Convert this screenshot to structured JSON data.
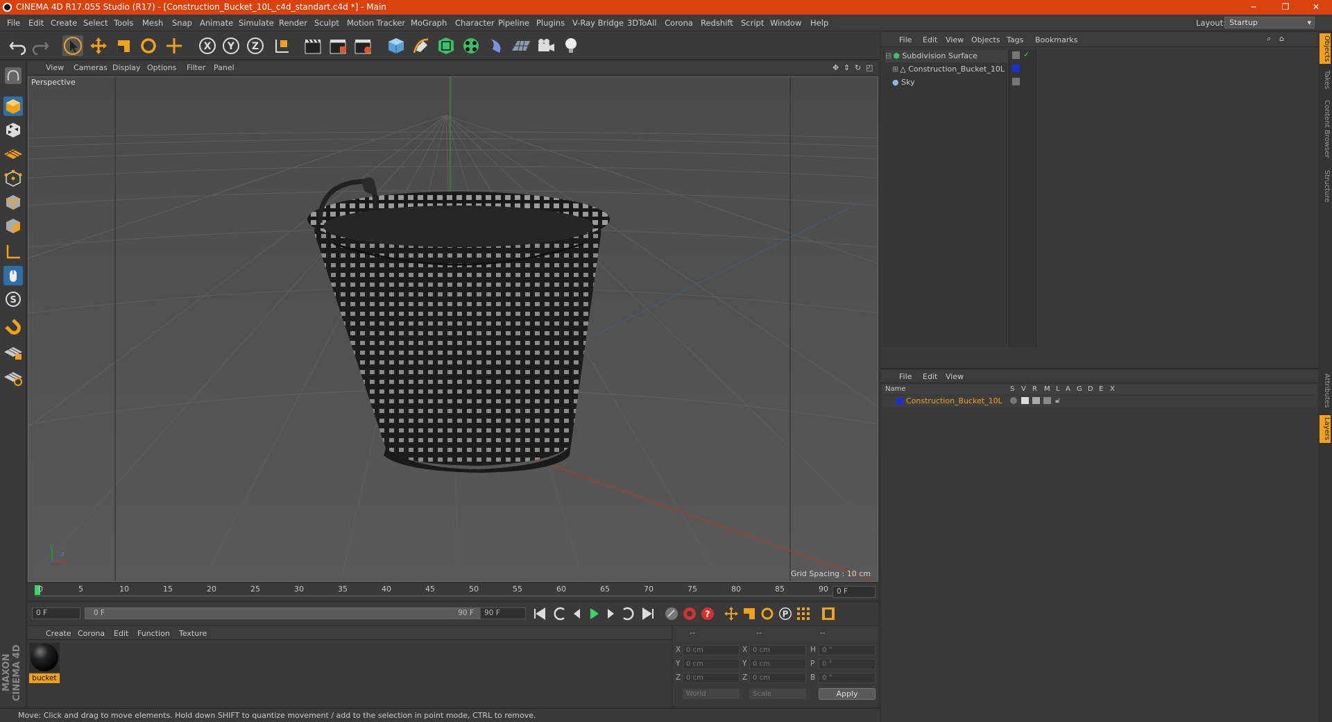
{
  "window": {
    "title": "CINEMA 4D R17.055 Studio (R17) - [Construction_Bucket_10L_c4d_standart.c4d *] - Main",
    "controls": [
      "─",
      "❐",
      "✕"
    ]
  },
  "menubar": {
    "items": [
      "File",
      "Edit",
      "Create",
      "Select",
      "Tools",
      "Mesh",
      "Snap",
      "Animate",
      "Simulate",
      "Render",
      "Sculpt",
      "Motion Tracker",
      "MoGraph",
      "Character",
      "Pipeline",
      "Plugins",
      "V-Ray Bridge",
      "3DToAll",
      "Corona",
      "Redshift",
      "Script",
      "Window",
      "Help"
    ],
    "layout_label": "Layout:",
    "layout_value": "Startup"
  },
  "toolbar": {
    "icons": [
      "undo-icon",
      "redo-icon",
      "select-arrow-icon",
      "move-icon",
      "scale-icon",
      "rotate-icon",
      "live-select-icon",
      "x-axis-icon",
      "y-axis-icon",
      "z-axis-icon",
      "coordinate-system-icon",
      "render-view-icon",
      "render-picture-viewer-icon",
      "edit-render-settings-icon",
      "cube-icon",
      "pen-icon",
      "subdivision-icon",
      "mograph-cloner-icon",
      "deformer-icon",
      "floor-icon",
      "camera-icon",
      "light-icon"
    ],
    "axis_labels": [
      "X",
      "Y",
      "Z"
    ]
  },
  "left_toolbar": {
    "icons": [
      "make-editable-icon",
      "model-mode-icon",
      "texture-mode-icon",
      "workplane-icon",
      "points-mode-icon",
      "edges-mode-icon",
      "polygons-mode-icon",
      "axis-mode-icon",
      "tweak-mode-icon",
      "solo-icon",
      "snap-icon",
      "locked-workplane-icon",
      "grid-snap-icon"
    ],
    "solo_label": "S"
  },
  "viewport": {
    "menu": [
      "View",
      "Cameras",
      "Display",
      "Options",
      "Filter",
      "Panel"
    ],
    "label": "Perspective",
    "grid_spacing": "Grid Spacing : 10 cm"
  },
  "timeline": {
    "ticks": [
      "0",
      "5",
      "10",
      "15",
      "20",
      "25",
      "30",
      "35",
      "40",
      "45",
      "50",
      "55",
      "60",
      "65",
      "70",
      "75",
      "80",
      "85",
      "90"
    ],
    "current_frame": "0 F",
    "start_frame": "0 F",
    "range_start": "0 F",
    "range_end": "90 F",
    "end_frame": "90 F"
  },
  "material_manager": {
    "menu": [
      "Create",
      "Corona",
      "Edit",
      "Function",
      "Texture"
    ],
    "material_name": "bucket",
    "brand": "MAXON CINEMA 4D"
  },
  "coordinates": {
    "header": [
      "--",
      "--",
      "--"
    ],
    "rows": [
      {
        "l1": "X",
        "v1": "0 cm",
        "l2": "X",
        "v2": "0 cm",
        "l3": "H",
        "v3": "0 °"
      },
      {
        "l1": "Y",
        "v1": "0 cm",
        "l2": "Y",
        "v2": "0 cm",
        "l3": "P",
        "v3": "0 °"
      },
      {
        "l1": "Z",
        "v1": "0 cm",
        "l2": "Z",
        "v2": "0 cm",
        "l3": "B",
        "v3": "0 °"
      }
    ],
    "mode1": "World",
    "mode2": "Scale",
    "apply": "Apply"
  },
  "status": "Move: Click and drag to move elements. Hold down SHIFT to quantize movement / add to the selection in point mode, CTRL to remove.",
  "object_manager": {
    "menu": [
      "File",
      "Edit",
      "View",
      "Objects",
      "Tags",
      "Bookmarks"
    ],
    "objects": [
      "Subdivision Surface",
      "Construction_Bucket_10L",
      "Sky"
    ]
  },
  "layer_manager": {
    "menu": [
      "File",
      "Edit",
      "View"
    ],
    "columns": [
      "Name",
      "S",
      "V",
      "R",
      "M",
      "L",
      "A",
      "G",
      "D",
      "E",
      "X"
    ],
    "layer_name": "Construction_Bucket_10L",
    "layer_color": "#1a2fd4"
  },
  "side_tabs": [
    "Objects",
    "Takes",
    "Content Browser",
    "Structure",
    "Attributes",
    "Layers"
  ],
  "colors": {
    "accent": "#d9420c",
    "highlight": "#f2a21a"
  }
}
